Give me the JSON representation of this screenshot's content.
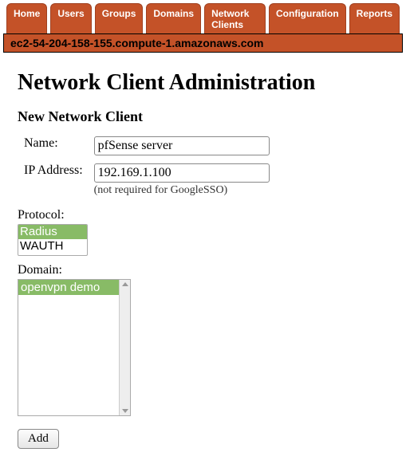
{
  "tabs": {
    "home": "Home",
    "users": "Users",
    "groups": "Groups",
    "domains": "Domains",
    "network_clients": "Network Clients",
    "configuration": "Configuration",
    "reports": "Reports"
  },
  "hostbar": "ec2-54-204-158-155.compute-1.amazonaws.com",
  "page_title": "Network Client Administration",
  "sub_title": "New Network Client",
  "labels": {
    "name": "Name:",
    "ip": "IP Address:",
    "ip_hint": "(not required for GoogleSSO)",
    "protocol": "Protocol:",
    "domain": "Domain:"
  },
  "form": {
    "name_value": "pfSense server",
    "ip_value": "192.169.1.100",
    "protocol_options": {
      "radius": "Radius",
      "wauth": "WAUTH"
    },
    "protocol_selected": "radius",
    "domain_options": {
      "openvpn_demo": "openvpn demo"
    },
    "domain_selected": "openvpn_demo"
  },
  "buttons": {
    "add": "Add"
  }
}
